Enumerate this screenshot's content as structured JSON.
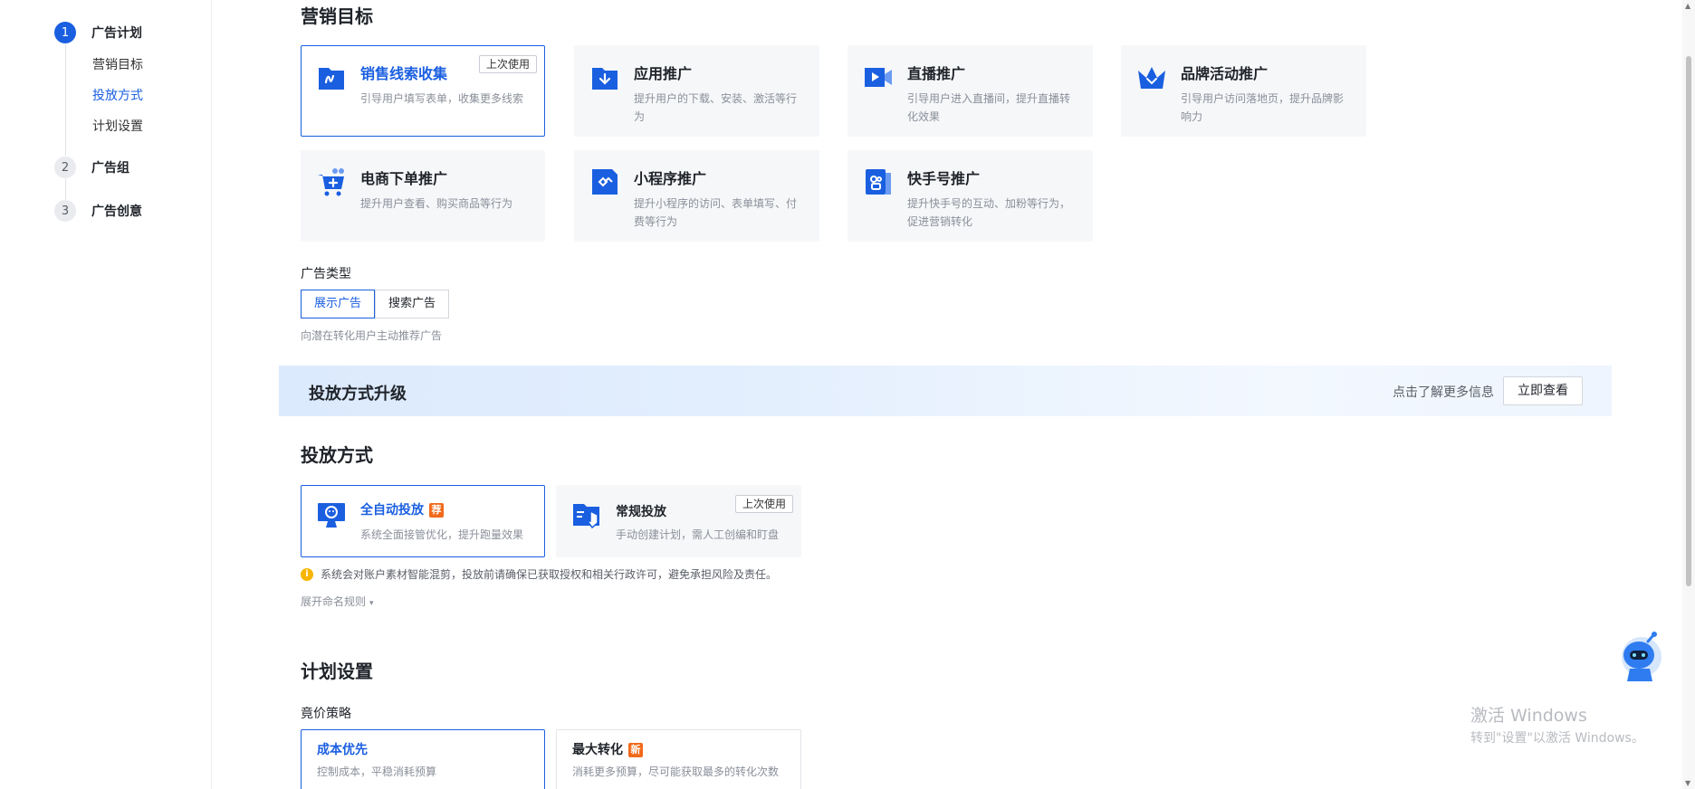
{
  "steps": [
    {
      "num": "1",
      "label": "广告计划",
      "active": true
    },
    {
      "num": "2",
      "label": "广告组",
      "active": false
    },
    {
      "num": "3",
      "label": "广告创意",
      "active": false
    }
  ],
  "substeps": [
    "营销目标",
    "投放方式",
    "计划设置"
  ],
  "marketing": {
    "title": "营销目标",
    "cards": [
      {
        "title": "销售线索收集",
        "desc": "引导用户填写表单，收集更多线索",
        "tag": "上次使用",
        "icon": "form-icon"
      },
      {
        "title": "应用推广",
        "desc": "提升用户的下载、安装、激活等行为",
        "icon": "download-icon"
      },
      {
        "title": "直播推广",
        "desc": "引导用户进入直播间，提升直播转化效果",
        "icon": "live-video-icon"
      },
      {
        "title": "品牌活动推广",
        "desc": "引导用户访问落地页，提升品牌影响力",
        "icon": "crown-icon"
      },
      {
        "title": "电商下单推广",
        "desc": "提升用户查看、购买商品等行为",
        "icon": "cart-icon"
      },
      {
        "title": "小程序推广",
        "desc": "提升小程序的访问、表单填写、付费等行为",
        "icon": "mini-program-icon"
      },
      {
        "title": "快手号推广",
        "desc": "提升快手号的互动、加粉等行为，促进营销转化",
        "icon": "kuaishou-icon"
      }
    ]
  },
  "ad_type": {
    "label": "广告类型",
    "options": [
      "展示广告",
      "搜索广告"
    ],
    "hint": "向潜在转化用户主动推荐广告"
  },
  "banner": {
    "title": "投放方式升级",
    "hint": "点击了解更多信息",
    "button": "立即查看"
  },
  "delivery": {
    "title": "投放方式",
    "cards": [
      {
        "title": "全自动投放",
        "badge": "荐",
        "desc": "系统全面接管优化，提升跑量效果",
        "icon": "monitor-robot-icon"
      },
      {
        "title": "常规投放",
        "desc": "手动创建计划，需人工创编和盯盘",
        "tag": "上次使用",
        "icon": "manual-click-icon"
      }
    ],
    "warning": "系统会对账户素材智能混剪，投放前请确保已获取授权和相关行政许可，避免承担风险及责任。",
    "expand": "展开命名规则"
  },
  "plan": {
    "title": "计划设置",
    "bid_label": "竟价策略",
    "cards": [
      {
        "title": "成本优先",
        "desc": "控制成本，平稳消耗预算"
      },
      {
        "title": "最大转化",
        "badge": "新",
        "desc": "消耗更多预算，尽可能获取最多的转化次数"
      }
    ]
  },
  "watermark": {
    "line1": "激活 Windows",
    "line2": "转到\"设置\"以激活 Windows。"
  },
  "colors": {
    "accent": "#1a5fe0",
    "badge": "#f06a1a",
    "warning": "#f7b500"
  }
}
